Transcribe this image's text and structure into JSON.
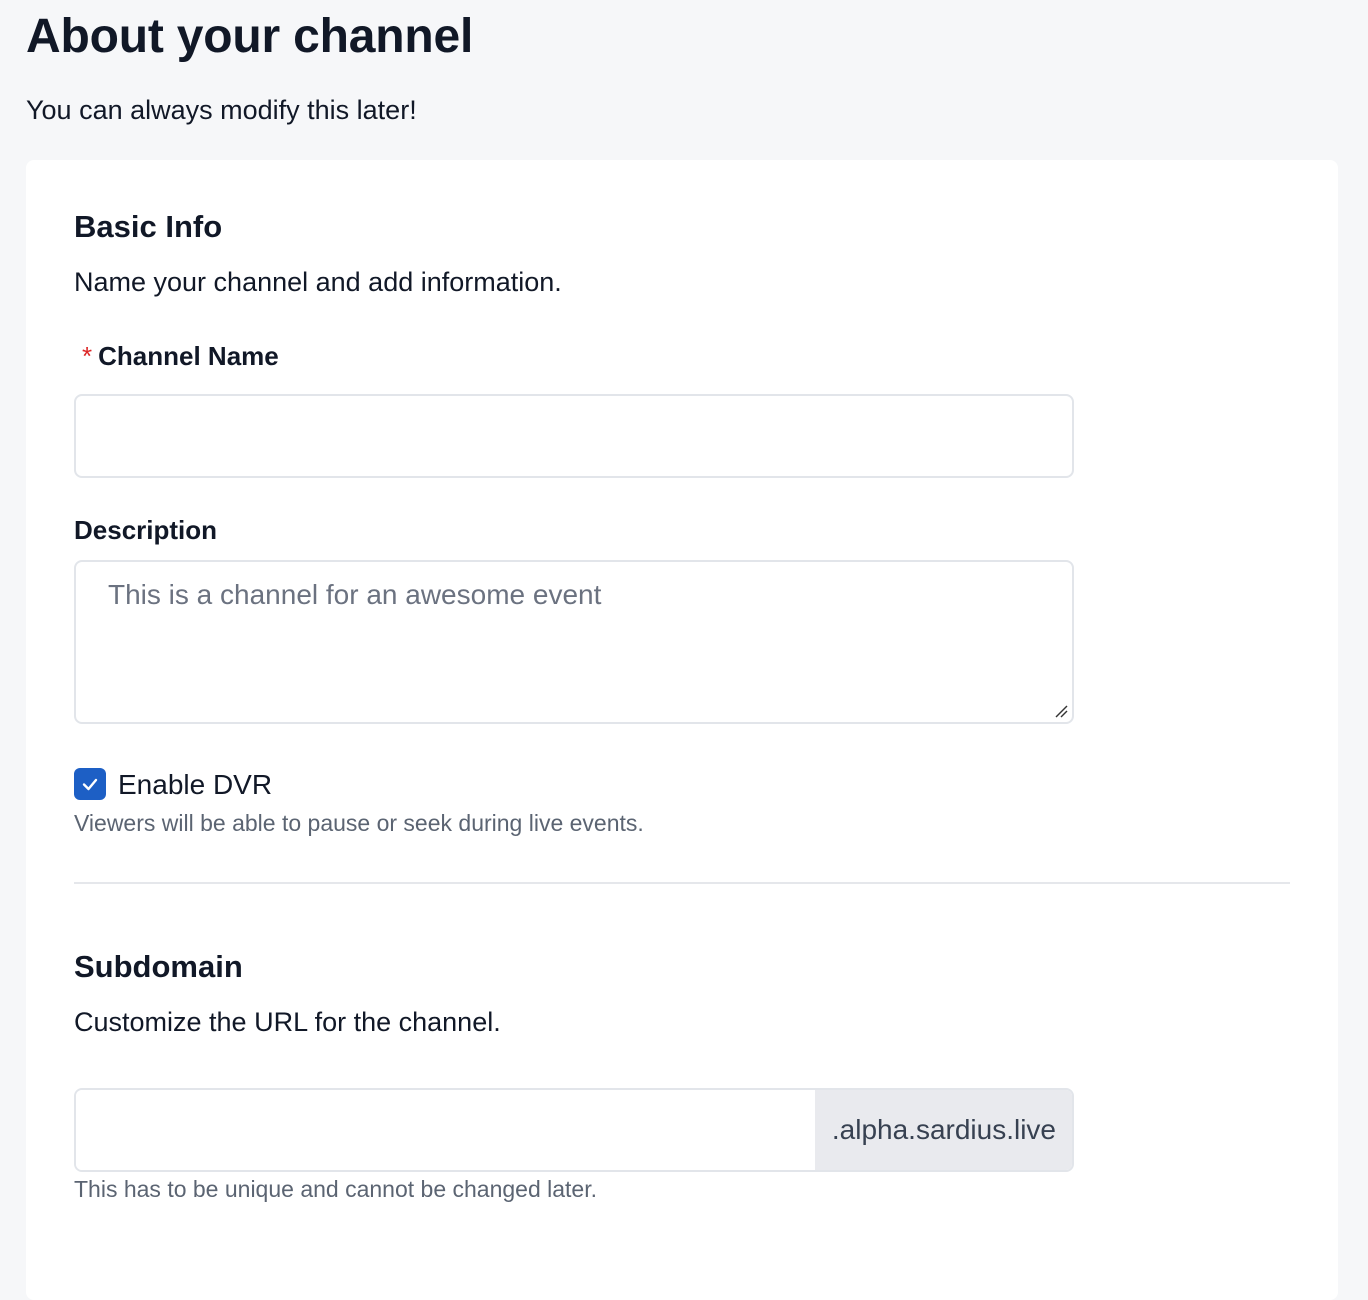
{
  "page": {
    "title": "About your channel",
    "subtitle": "You can always modify this later!"
  },
  "basic_info": {
    "title": "Basic Info",
    "description": "Name your channel and add information.",
    "channel_name": {
      "required_marker": "*",
      "label": "Channel Name",
      "value": ""
    },
    "description_field": {
      "label": "Description",
      "placeholder": "This is a channel for an awesome event",
      "value": ""
    },
    "dvr": {
      "checked": true,
      "label": "Enable DVR",
      "helper": "Viewers will be able to pause or seek during live events."
    }
  },
  "subdomain": {
    "title": "Subdomain",
    "description": "Customize the URL for the channel.",
    "value": "",
    "suffix": ".alpha.sardius.live",
    "helper": "This has to be unique and cannot be changed later."
  },
  "colors": {
    "accent": "#1d5fc5",
    "required": "#dc2626",
    "background": "#f6f7f9",
    "addon_bg": "#e9eaee"
  },
  "icons": {
    "checkbox": "check-icon",
    "resize": "resize-handle-icon"
  }
}
